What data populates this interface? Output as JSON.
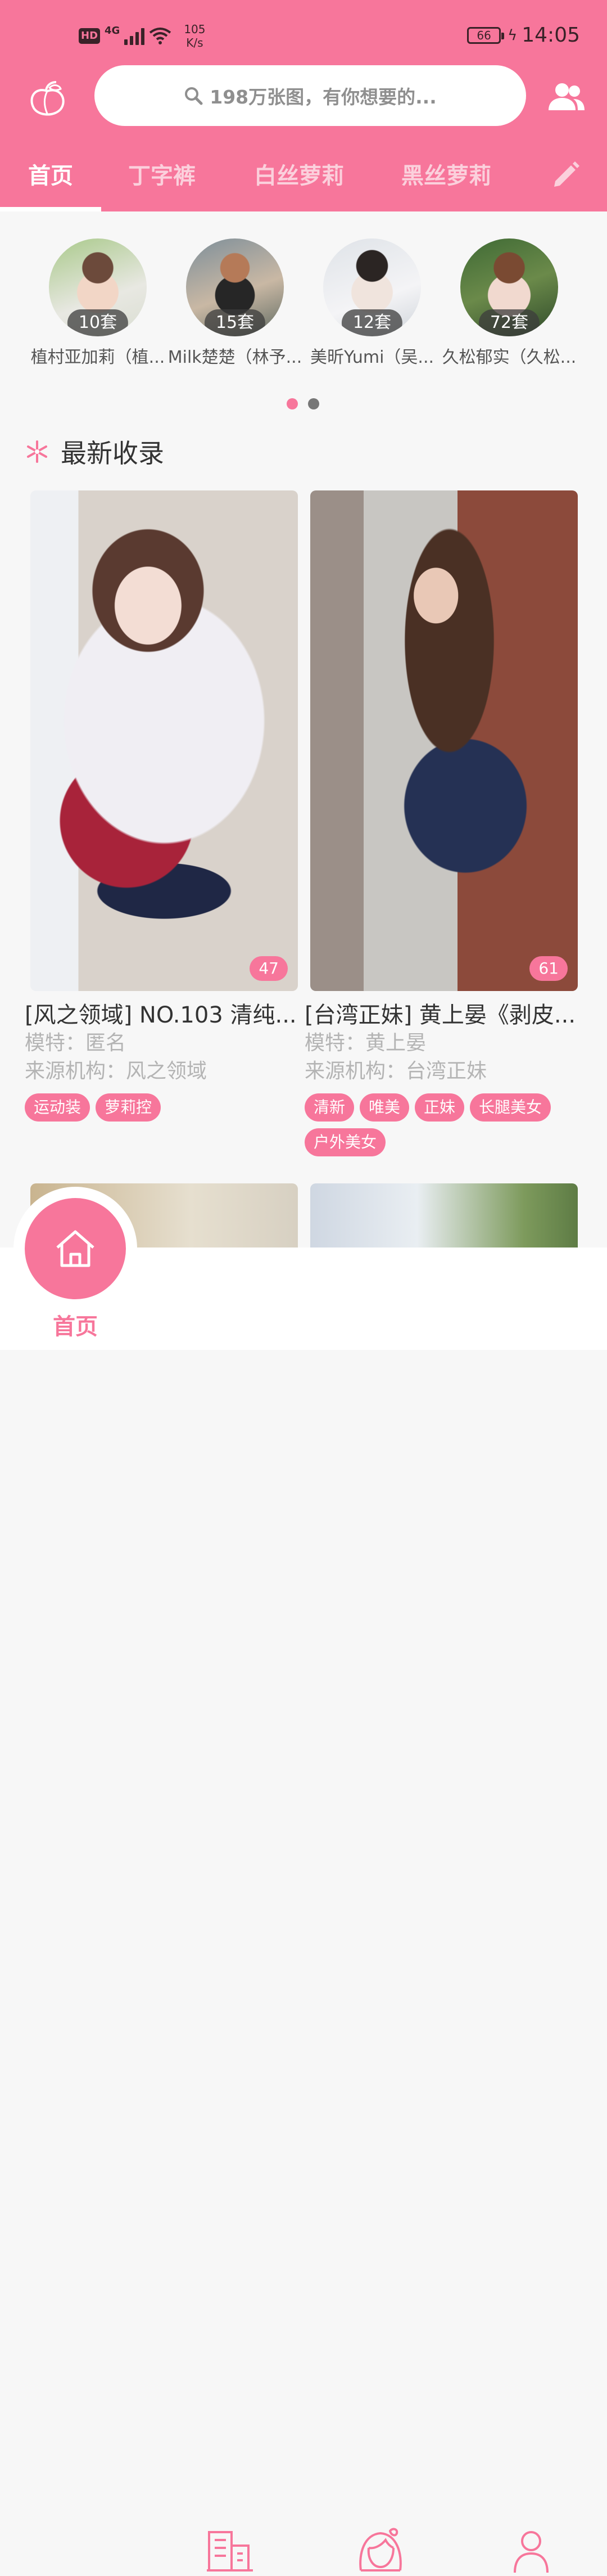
{
  "status_bar": {
    "hd": "HD",
    "network": "4G",
    "speed_value": "105",
    "speed_unit": "K/s",
    "battery": "66",
    "time": "14:05"
  },
  "header": {
    "search_placeholder": "198万张图，有你想要的...",
    "tabs": [
      {
        "label": "首页",
        "active": true
      },
      {
        "label": "丁字裤",
        "active": false
      },
      {
        "label": "白丝萝莉",
        "active": false
      },
      {
        "label": "黑丝萝莉",
        "active": false
      }
    ]
  },
  "models": [
    {
      "name": "植村亚加莉（植...",
      "count": "10套"
    },
    {
      "name": "Milk楚楚（林予...",
      "count": "15套"
    },
    {
      "name": "美昕Yumi（吴...",
      "count": "12套"
    },
    {
      "name": "久松郁实（久松...",
      "count": "72套"
    }
  ],
  "section": {
    "title": "最新收录"
  },
  "cards": [
    {
      "title": "[风之领域] NO.103 清纯...",
      "model": "模特：匿名",
      "source": "来源机构：风之领域",
      "count": "47",
      "tags": [
        "运动装",
        "萝莉控"
      ]
    },
    {
      "title": "[台湾正妹] 黄上晏《剥皮...",
      "model": "模特：黄上晏",
      "source": "来源机构：台湾正妹",
      "count": "61",
      "tags": [
        "清新",
        "唯美",
        "正妹",
        "长腿美女",
        "户外美女"
      ]
    }
  ],
  "bottom_nav": {
    "home_label": "首页",
    "icons": [
      "home-icon",
      "building-icon",
      "girl-face-icon",
      "person-icon"
    ]
  },
  "colors": {
    "accent": "#f7769b"
  }
}
